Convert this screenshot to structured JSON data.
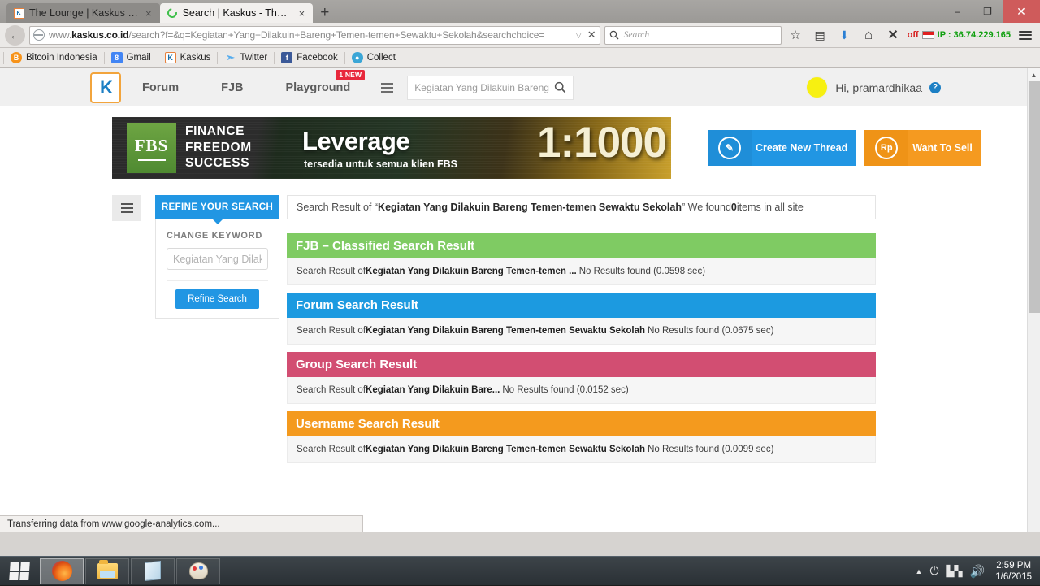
{
  "window": {
    "tabs": [
      {
        "title": "The Lounge | Kaskus - The ...",
        "favicon": "kaskus-favicon",
        "active": false
      },
      {
        "title": "Search | Kaskus - The Large...",
        "favicon": "loading-spinner-icon",
        "active": true
      }
    ],
    "new_tab_label": "+",
    "close_label": "×",
    "controls": {
      "minimize": "–",
      "restore": "❐",
      "close": "✕"
    }
  },
  "toolbar": {
    "back_icon": "←",
    "url_prefix": "www.",
    "url_domain": "kaskus.co.id",
    "url_rest": "/search?f=&q=Kegiatan+Yang+Dilakuin+Bareng+Temen-temen+Sewaktu+Sekolah&searchchoice=",
    "url_dropdown": "▽",
    "url_stop": "✕",
    "search_placeholder": "Search",
    "bookmark_icon": "☆",
    "reader_icon": "▤",
    "download_icon": "⬇",
    "home_icon": "⌂",
    "x_icon": "✕",
    "ip_status": "off",
    "ip_label": "IP : 36.74.229.165",
    "menu_icon": "hamburger-icon"
  },
  "bookmarks": [
    {
      "label": "Bitcoin Indonesia",
      "glyph": "Ƀ",
      "color": "#f7931a"
    },
    {
      "label": "Gmail",
      "glyph": "8",
      "color": "#4285f4"
    },
    {
      "label": "Kaskus",
      "glyph": "K",
      "color": "#ffffff"
    },
    {
      "label": "Twitter",
      "glyph": "t",
      "color": "#55acee"
    },
    {
      "label": "Facebook",
      "glyph": "f",
      "color": "#3b5998"
    },
    {
      "label": "Collect",
      "glyph": "◉",
      "color": "#3ba6d6"
    }
  ],
  "site": {
    "logo_text": "K",
    "nav": [
      {
        "label": "Forum",
        "badge": ""
      },
      {
        "label": "FJB",
        "badge": ""
      },
      {
        "label": "Playground",
        "badge": "1 NEW"
      }
    ],
    "header_search_value": "Kegiatan Yang Dilakuin Bareng T",
    "search_icon": "search-icon",
    "user_greeting": "Hi, pramardhikaa",
    "help_glyph": "?"
  },
  "banner": {
    "logo": "FBS",
    "tagline_lines": [
      "FINANCE",
      "FREEDOM",
      "SUCCESS"
    ],
    "headline": "Leverage",
    "subhead": "tersedia untuk semua klien FBS",
    "ratio": "1:1000"
  },
  "action_buttons": [
    {
      "label": "Create New Thread",
      "icon_glyph": "✎",
      "color": "#2196e3"
    },
    {
      "label": "Want To Sell",
      "icon_glyph": "Rp",
      "color": "#f59a20"
    }
  ],
  "refine": {
    "tab_label": "REFINE YOUR SEARCH",
    "change_keyword_label": "CHANGE KEYWORD",
    "keyword_placeholder": "Kegiatan Yang Dilakuin Bareng Temen-temen Sewaktu Sekolah",
    "button_label": "Refine Search",
    "toggle_icon": "list-toggle-icon"
  },
  "result_header": {
    "prefix": "Search Result of “",
    "query": "Kegiatan Yang Dilakuin Bareng Temen-temen Sewaktu Sekolah",
    "middle": "” We found ",
    "count": "0",
    "suffix": " items in all site"
  },
  "sections": [
    {
      "title": "FJB – Classified Search Result",
      "color": "#7fcb63",
      "body_prefix": "Search Result of ",
      "body_query": "Kegiatan Yang Dilakuin Bareng Temen-temen ...",
      "body_status": "No Results found (0.0598 sec)"
    },
    {
      "title": "Forum Search Result",
      "color": "#1c9ae0",
      "body_prefix": "Search Result of ",
      "body_query": "Kegiatan Yang Dilakuin Bareng Temen-temen Sewaktu Sekolah",
      "body_status": "No Results found (0.0675 sec)"
    },
    {
      "title": "Group Search Result",
      "color": "#d24e72",
      "body_prefix": "Search Result of ",
      "body_query": "Kegiatan Yang Dilakuin Bare...",
      "body_status": "No Results found (0.0152 sec)"
    },
    {
      "title": "Username Search Result",
      "color": "#f49a1e",
      "body_prefix": "Search Result of ",
      "body_query": "Kegiatan Yang Dilakuin Bareng Temen-temen Sewaktu Sekolah",
      "body_status": "No Results found (0.0099 sec)"
    }
  ],
  "status_bar": {
    "text": "Transferring data from www.google-analytics.com..."
  },
  "taskbar": {
    "start_label": "Start",
    "items": [
      {
        "name": "firefox",
        "active": true
      },
      {
        "name": "file-explorer",
        "active": false
      },
      {
        "name": "notepad",
        "active": false
      },
      {
        "name": "paint",
        "active": false
      }
    ],
    "tray": {
      "caret": "▲",
      "time": "2:59 PM",
      "date": "1/6/2015"
    }
  }
}
